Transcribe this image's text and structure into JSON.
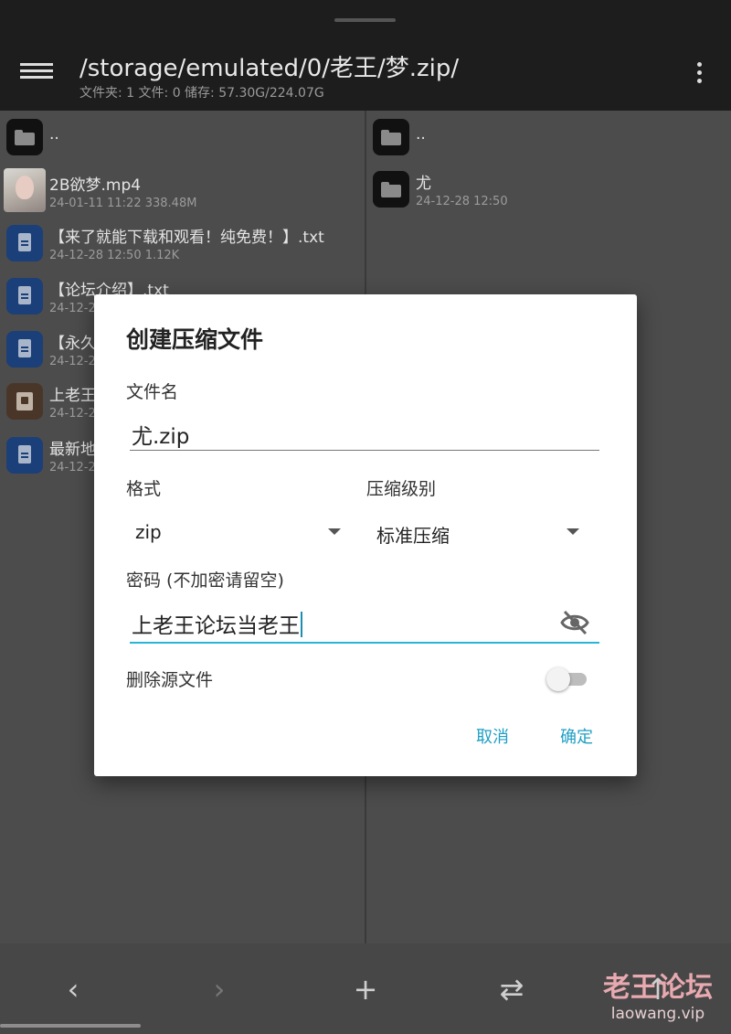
{
  "appbar": {
    "path": "/storage/emulated/0/老王/梦.zip/",
    "stats": "文件夹: 1  文件: 0  储存: 57.30G/224.07G"
  },
  "left_pane": {
    "items": [
      {
        "name": "..",
        "meta": "",
        "icon": "folder-icon"
      },
      {
        "name": "2B欲梦.mp4",
        "meta": "24-01-11 11:22  338.48M",
        "icon": "video-thumbnail"
      },
      {
        "name": "【来了就能下载和观看！纯免费！】.txt",
        "meta": "24-12-28 12:50  1.12K",
        "icon": "document-icon"
      },
      {
        "name": "【论坛介绍】.txt",
        "meta": "24-12-2",
        "icon": "document-icon"
      },
      {
        "name": "【永久地",
        "meta": "24-12-2",
        "icon": "document-icon"
      },
      {
        "name": "上老王",
        "meta": "24-12-2",
        "icon": "archive-icon"
      },
      {
        "name": "最新地",
        "meta": "24-12-2",
        "icon": "document-icon"
      }
    ]
  },
  "right_pane": {
    "items": [
      {
        "name": "..",
        "meta": "",
        "icon": "folder-icon"
      },
      {
        "name": "尤",
        "meta": "24-12-28 12:50",
        "icon": "folder-icon"
      }
    ]
  },
  "dialog": {
    "title": "创建压缩文件",
    "filename_label": "文件名",
    "filename_value": "尤.zip",
    "format_label": "格式",
    "format_value": "zip",
    "level_label": "压缩级别",
    "level_value": "标准压缩",
    "password_label": "密码 (不加密请留空)",
    "password_value": "上老王论坛当老王",
    "delete_source_label": "删除源文件",
    "delete_source_on": false,
    "cancel_label": "取消",
    "confirm_label": "确定",
    "accent_color": "#29b6d6"
  },
  "toolbar": {
    "back_icon": "‹",
    "forward_icon": "›",
    "add_icon": "+",
    "swap_icon": "⇄",
    "up_icon": "↑"
  },
  "watermark": {
    "main": "老王论坛",
    "sub": "laowang.vip"
  }
}
